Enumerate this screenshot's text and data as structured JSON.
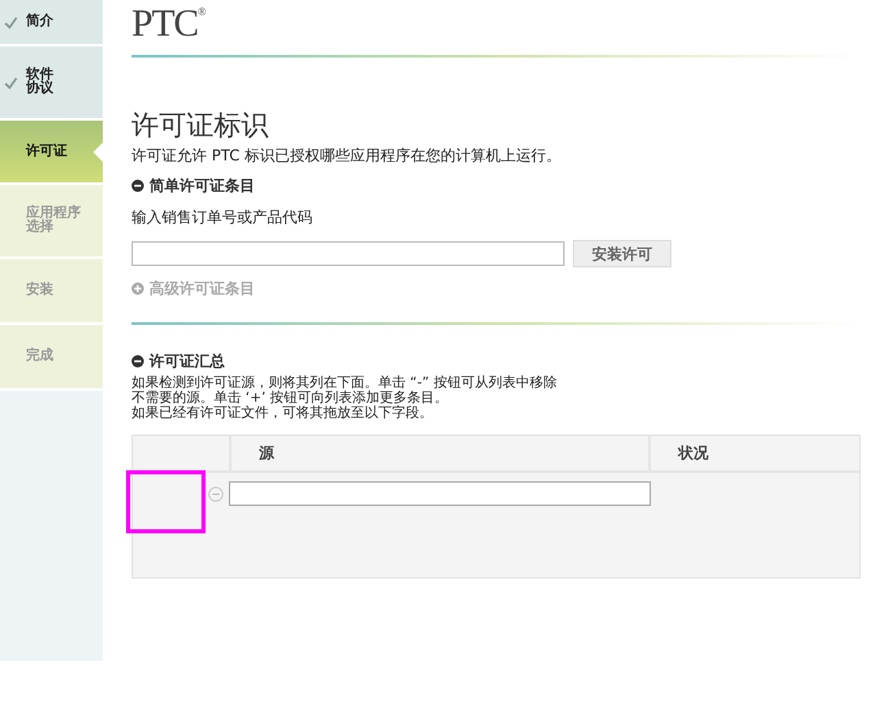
{
  "sidebar": {
    "steps": [
      {
        "lines": [
          "简介"
        ],
        "done": true,
        "selected": false
      },
      {
        "lines": [
          "软件",
          "协议"
        ],
        "done": true,
        "selected": false
      },
      {
        "lines": [
          "许可证"
        ],
        "done": false,
        "selected": true
      },
      {
        "lines": [
          "应用程序",
          "选择"
        ],
        "done": false,
        "selected": false
      },
      {
        "lines": [
          "安装"
        ],
        "done": false,
        "selected": false
      },
      {
        "lines": [
          "完成"
        ],
        "done": false,
        "selected": false
      }
    ]
  },
  "logo": {
    "text": "PTC",
    "mark": "®"
  },
  "title": "许可证标识",
  "description": "许可证允许 PTC 标识已授权哪些应用程序在您的计算机上运行。",
  "simple_entry": {
    "heading": "简单许可证条目",
    "expanded": true,
    "label": "输入销售订单号或产品代码",
    "button": "安装许可"
  },
  "advanced_entry": {
    "heading": "高级许可证条目",
    "expanded": false
  },
  "summary": {
    "heading": "许可证汇总",
    "expanded": true,
    "lines": [
      "如果检测到许可证源，则将其列在下面。单击 “-” 按钮可从列表中移除",
      "不需要的源。单击 ‘+’ 按钮可向列表添加更多条目。",
      "如果已经有许可证文件，可将其拖放至以下字段。"
    ],
    "table": {
      "columns": [
        "源",
        "状况"
      ],
      "rows": [
        {
          "source": ""
        }
      ]
    }
  }
}
